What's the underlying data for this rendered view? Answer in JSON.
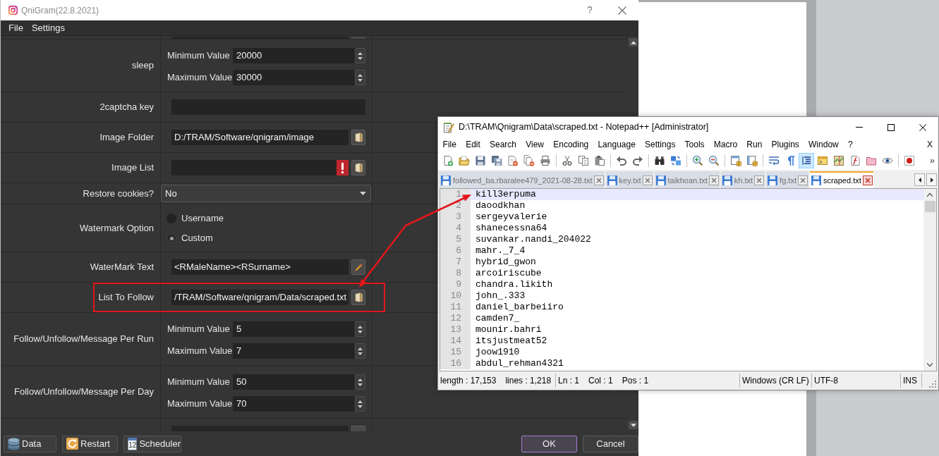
{
  "qnigram": {
    "window": {
      "title": "QniGram(22.8.2021)",
      "help": "?"
    },
    "menu": [
      "File",
      "Settings"
    ],
    "settings": [
      {
        "kind": "cut_top"
      },
      {
        "kind": "range",
        "label": "sleep",
        "fields": [
          {
            "label": "Minimum Value",
            "value": "20000"
          },
          {
            "label": "Maximum Value",
            "value": "30000"
          }
        ]
      },
      {
        "kind": "text",
        "label": "2captcha key"
      },
      {
        "kind": "path",
        "label": "Image Folder",
        "value": "D:/TRAM/Software/qnigram/image",
        "error": false,
        "highlighted": false
      },
      {
        "kind": "path",
        "label": "Image List",
        "error": true,
        "highlighted": false
      },
      {
        "kind": "dropdown",
        "label": "Restore cookies?",
        "value": "No"
      },
      {
        "kind": "radio",
        "label": "Watermark Option",
        "options": [
          {
            "label": "Username",
            "selected": false
          },
          {
            "label": "Custom",
            "selected": true
          }
        ]
      },
      {
        "kind": "edit",
        "label": "WaterMark Text",
        "value": "<RMaleName><RSurname>"
      },
      {
        "kind": "path",
        "label": "List To Follow",
        "value": "/TRAM/Software/qnigram/Data/scraped.txt",
        "error": false,
        "highlighted": true
      },
      {
        "kind": "range",
        "label": "Follow/Unfollow/Message Per Run",
        "fields": [
          {
            "label": "Minimum Value",
            "value": "5"
          },
          {
            "label": "Maximum Value",
            "value": "7"
          }
        ]
      },
      {
        "kind": "range",
        "label": "Follow/Unfollow/Message Per Day",
        "fields": [
          {
            "label": "Minimum Value",
            "value": "50"
          },
          {
            "label": "Maximum Value",
            "value": "70"
          }
        ]
      },
      {
        "kind": "cut_bottom"
      }
    ],
    "buttons": [
      {
        "kind": "data",
        "label": "Data"
      },
      {
        "kind": "restart",
        "label": "Restart"
      },
      {
        "kind": "scheduler",
        "label": "Scheduler",
        "icon_text": "12"
      }
    ],
    "dialog_buttons": [
      {
        "label": "OK",
        "default": true
      },
      {
        "label": "Cancel",
        "default": false
      }
    ]
  },
  "notepad": {
    "window": {
      "title": "D:\\TRAM\\Qnigram\\Data\\scraped.txt - Notepad++ [Administrator]"
    },
    "menu": [
      "File",
      "Edit",
      "Search",
      "View",
      "Encoding",
      "Language",
      "Settings",
      "Tools",
      "Macro",
      "Run",
      "Plugins",
      "Window",
      "?"
    ],
    "menu_close": "X",
    "toolbar": [
      [
        {
          "kind": "new",
          "on": false
        },
        {
          "kind": "open",
          "on": false
        },
        {
          "kind": "save",
          "on": false
        },
        {
          "kind": "save_all",
          "on": false
        },
        {
          "kind": "close",
          "on": false
        },
        {
          "kind": "close_all",
          "on": false
        },
        {
          "kind": "print",
          "on": false
        }
      ],
      [
        {
          "kind": "cut",
          "on": false
        },
        {
          "kind": "copy",
          "on": false
        },
        {
          "kind": "paste",
          "on": false
        }
      ],
      [
        {
          "kind": "undo",
          "on": false
        },
        {
          "kind": "redo",
          "on": false
        }
      ],
      [
        {
          "kind": "find",
          "on": false
        },
        {
          "kind": "replace",
          "on": false
        }
      ],
      [
        {
          "kind": "zoom_in",
          "on": false
        },
        {
          "kind": "zoom_out",
          "on": false
        }
      ],
      [
        {
          "kind": "sync_v",
          "on": false
        },
        {
          "kind": "sync_h",
          "on": false
        }
      ],
      [
        {
          "kind": "wrap",
          "on": false
        },
        {
          "kind": "all_chars",
          "on": false
        },
        {
          "kind": "indent_guide",
          "on": true
        },
        {
          "kind": "udl",
          "on": false
        },
        {
          "kind": "doc_map",
          "on": false
        },
        {
          "kind": "function_list",
          "on": false
        },
        {
          "kind": "workspace",
          "on": false
        },
        {
          "kind": "monitor",
          "on": false
        }
      ],
      [
        {
          "kind": "record",
          "on": false
        }
      ]
    ],
    "toolbar_more": "»",
    "tabs": [
      {
        "label": "followed_ba.rbaralee479_2021-08-28.txt",
        "selected": false
      },
      {
        "label": "key.txt",
        "selected": false
      },
      {
        "label": "taikhoan.txt",
        "selected": false
      },
      {
        "label": "kh.txt",
        "selected": false
      },
      {
        "label": "fg.txt",
        "selected": false
      },
      {
        "label": "scraped.txt",
        "selected": true
      }
    ],
    "lines": [
      {
        "number": "1",
        "text": "kill3erpuma",
        "current": true
      },
      {
        "number": "2",
        "text": "daoodkhan",
        "current": false
      },
      {
        "number": "3",
        "text": "sergeyvalerie",
        "current": false
      },
      {
        "number": "4",
        "text": "shanecessna64",
        "current": false
      },
      {
        "number": "5",
        "text": "suvankar.nandi_204022",
        "current": false
      },
      {
        "number": "6",
        "text": "mahr._7_4",
        "current": false
      },
      {
        "number": "7",
        "text": "hybrid_gwon",
        "current": false
      },
      {
        "number": "8",
        "text": "arcoiriscube",
        "current": false
      },
      {
        "number": "9",
        "text": "chandra.likith",
        "current": false
      },
      {
        "number": "10",
        "text": "john_.333",
        "current": false
      },
      {
        "number": "11",
        "text": "daniel_barbeiiro",
        "current": false
      },
      {
        "number": "12",
        "text": "camden7_",
        "current": false
      },
      {
        "number": "13",
        "text": "mounir.bahri",
        "current": false
      },
      {
        "number": "14",
        "text": "itsjustmeat52",
        "current": false
      },
      {
        "number": "15",
        "text": "joow1910",
        "current": false
      },
      {
        "number": "16",
        "text": "abdul_rehman4321",
        "current": false
      }
    ],
    "status_bar": [
      {
        "texts": [
          "length : 17,153",
          "lines : 1,218"
        ]
      },
      {
        "texts": [
          "Ln : 1",
          "Col : 1",
          "Pos : 1"
        ]
      },
      {
        "texts": [
          "Windows (CR LF)"
        ]
      },
      {
        "texts": [
          "UTF-8"
        ]
      },
      {
        "texts": [
          "INS"
        ]
      }
    ]
  }
}
